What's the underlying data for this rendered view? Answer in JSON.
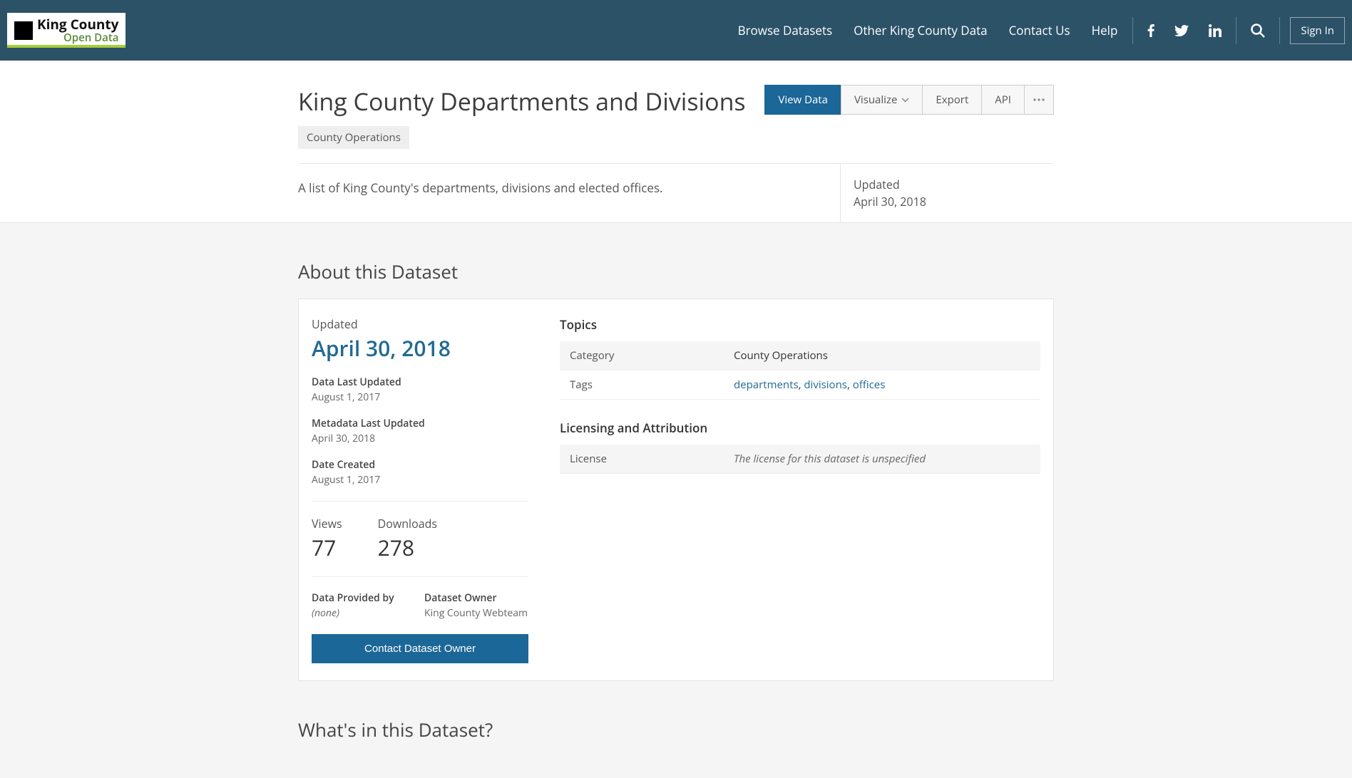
{
  "header": {
    "logo": {
      "line1": "King County",
      "line2": "Open Data"
    },
    "nav": [
      "Browse Datasets",
      "Other King County Data",
      "Contact Us",
      "Help"
    ],
    "signin": "Sign In"
  },
  "page": {
    "title": "King County Departments and Divisions",
    "category_chip": "County Operations",
    "description": "A list of King County's departments, divisions and elected offices.",
    "updated_label": "Updated",
    "updated_date": "April 30, 2018"
  },
  "tabs": {
    "view_data": "View Data",
    "visualize": "Visualize",
    "export": "Export",
    "api": "API"
  },
  "about": {
    "heading": "About this Dataset",
    "updated_label": "Updated",
    "updated_value": "April 30, 2018",
    "data_last_updated_label": "Data Last Updated",
    "data_last_updated_value": "August 1, 2017",
    "metadata_last_updated_label": "Metadata Last Updated",
    "metadata_last_updated_value": "April 30, 2018",
    "date_created_label": "Date Created",
    "date_created_value": "August 1, 2017",
    "views_label": "Views",
    "views_value": "77",
    "downloads_label": "Downloads",
    "downloads_value": "278",
    "provided_by_label": "Data Provided by",
    "provided_by_value": "(none)",
    "owner_label": "Dataset Owner",
    "owner_value": "King County Webteam",
    "contact_button": "Contact Dataset Owner"
  },
  "topics": {
    "heading": "Topics",
    "category_label": "Category",
    "category_value": "County Operations",
    "tags_label": "Tags",
    "tags": [
      "departments",
      "divisions",
      "offices"
    ]
  },
  "licensing": {
    "heading": "Licensing and Attribution",
    "license_label": "License",
    "license_value": "The license for this dataset is unspecified"
  },
  "whats_in": "What's in this Dataset?"
}
